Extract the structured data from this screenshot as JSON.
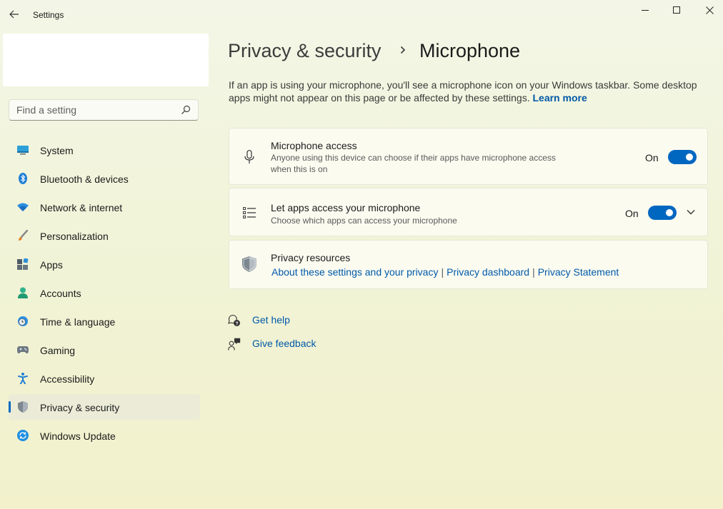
{
  "window": {
    "title": "Settings",
    "controls": [
      "minimize-icon",
      "maximize-icon",
      "close-icon"
    ]
  },
  "search": {
    "placeholder": "Find a setting",
    "value": ""
  },
  "sidebar": {
    "items": [
      {
        "label": "System",
        "icon": "system-icon",
        "active": false
      },
      {
        "label": "Bluetooth & devices",
        "icon": "bluetooth-icon",
        "active": false
      },
      {
        "label": "Network & internet",
        "icon": "wifi-icon",
        "active": false
      },
      {
        "label": "Personalization",
        "icon": "brush-icon",
        "active": false
      },
      {
        "label": "Apps",
        "icon": "apps-icon",
        "active": false
      },
      {
        "label": "Accounts",
        "icon": "person-icon",
        "active": false
      },
      {
        "label": "Time & language",
        "icon": "globe-clock-icon",
        "active": false
      },
      {
        "label": "Gaming",
        "icon": "gamepad-icon",
        "active": false
      },
      {
        "label": "Accessibility",
        "icon": "accessibility-icon",
        "active": false
      },
      {
        "label": "Privacy & security",
        "icon": "shield-icon",
        "active": true
      },
      {
        "label": "Windows Update",
        "icon": "update-icon",
        "active": false
      }
    ]
  },
  "header": {
    "parent": "Privacy & security",
    "current": "Microphone"
  },
  "description": {
    "text": "If an app is using your microphone, you'll see a microphone icon on your Windows taskbar. Some desktop apps might not appear on this page or be affected by these settings.",
    "link": "Learn more"
  },
  "cards": {
    "mic_access": {
      "title": "Microphone access",
      "subtitle": "Anyone using this device can choose if their apps have microphone access when this is on",
      "state": "On",
      "enabled": true
    },
    "let_apps": {
      "title": "Let apps access your microphone",
      "subtitle": "Choose which apps can access your microphone",
      "state": "On",
      "enabled": true
    },
    "privacy_resources": {
      "title": "Privacy resources",
      "links": [
        "About these settings and your privacy",
        "Privacy dashboard",
        "Privacy Statement"
      ]
    }
  },
  "help": {
    "get_help": "Get help",
    "give_feedback": "Give feedback"
  },
  "colors": {
    "accent": "#0067c0",
    "link": "#0059a9"
  }
}
